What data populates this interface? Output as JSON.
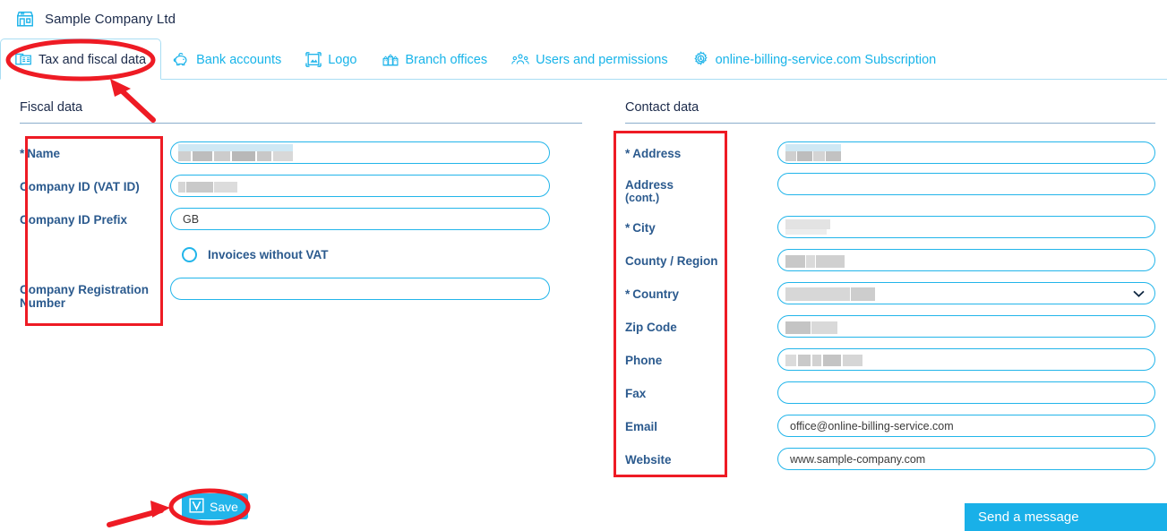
{
  "header": {
    "company_icon": "shop-icon",
    "company_name": "Sample Company Ltd"
  },
  "tabs": [
    {
      "label": "Tax and fiscal data",
      "icon": "tax-documents-icon",
      "active": true
    },
    {
      "label": "Bank accounts",
      "icon": "piggy-bank-icon",
      "active": false
    },
    {
      "label": "Logo",
      "icon": "image-frame-icon",
      "active": false
    },
    {
      "label": "Branch offices",
      "icon": "buildings-icon",
      "active": false
    },
    {
      "label": "Users and permissions",
      "icon": "users-group-icon",
      "active": false
    },
    {
      "label": "online-billing-service.com Subscription",
      "icon": "gear-icon",
      "active": false
    }
  ],
  "fiscal": {
    "section_title": "Fiscal data",
    "fields": [
      {
        "label": "Name",
        "required": true,
        "value": "",
        "redacted": true,
        "type": "text"
      },
      {
        "label": "Company ID (VAT ID)",
        "required": false,
        "value": "",
        "redacted": true,
        "type": "text"
      },
      {
        "label": "Company ID Prefix",
        "required": false,
        "value": "GB",
        "redacted": false,
        "type": "text"
      },
      {
        "label": "Company Registration Number",
        "required": false,
        "value": "",
        "redacted": false,
        "type": "text"
      }
    ],
    "checkbox": {
      "label": "Invoices without VAT",
      "checked": false
    }
  },
  "contact": {
    "section_title": "Contact data",
    "fields": [
      {
        "label": "Address",
        "sub": "",
        "required": true,
        "value": "",
        "redacted": true,
        "type": "text"
      },
      {
        "label": "Address",
        "sub": "(cont.)",
        "required": false,
        "value": "",
        "redacted": false,
        "type": "text"
      },
      {
        "label": "City",
        "sub": "",
        "required": true,
        "value": "",
        "redacted": true,
        "type": "text"
      },
      {
        "label": "County / Region",
        "sub": "",
        "required": false,
        "value": "",
        "redacted": true,
        "type": "text"
      },
      {
        "label": "Country",
        "sub": "",
        "required": true,
        "value": "",
        "redacted": true,
        "type": "select"
      },
      {
        "label": "Zip Code",
        "sub": "",
        "required": false,
        "value": "",
        "redacted": true,
        "type": "text"
      },
      {
        "label": "Phone",
        "sub": "",
        "required": false,
        "value": "",
        "redacted": true,
        "type": "text"
      },
      {
        "label": "Fax",
        "sub": "",
        "required": false,
        "value": "",
        "redacted": false,
        "type": "text"
      },
      {
        "label": "Email",
        "sub": "",
        "required": false,
        "value": "office@online-billing-service.com",
        "redacted": false,
        "type": "text"
      },
      {
        "label": "Website",
        "sub": "",
        "required": false,
        "value": "www.sample-company.com",
        "redacted": false,
        "type": "text"
      }
    ]
  },
  "actions": {
    "save_label": "Save",
    "save_icon": "checkbox-check-icon",
    "send_message_label": "Send a message"
  },
  "colors": {
    "accent_cyan": "#22b5ea",
    "send_button": "#19b0e8",
    "label_blue": "#2b5a8e",
    "heading_navy": "#1b2a4a",
    "annotation_red": "#ee1b24"
  },
  "annotations": [
    {
      "name": "tab-highlight-ellipse",
      "shape": "ellipse"
    },
    {
      "name": "tab-pointer-arrow",
      "shape": "arrow"
    },
    {
      "name": "fiscal-labels-box",
      "shape": "rect"
    },
    {
      "name": "contact-labels-box",
      "shape": "rect"
    },
    {
      "name": "save-highlight-ellipse",
      "shape": "ellipse"
    },
    {
      "name": "save-pointer-arrow",
      "shape": "arrow"
    }
  ]
}
